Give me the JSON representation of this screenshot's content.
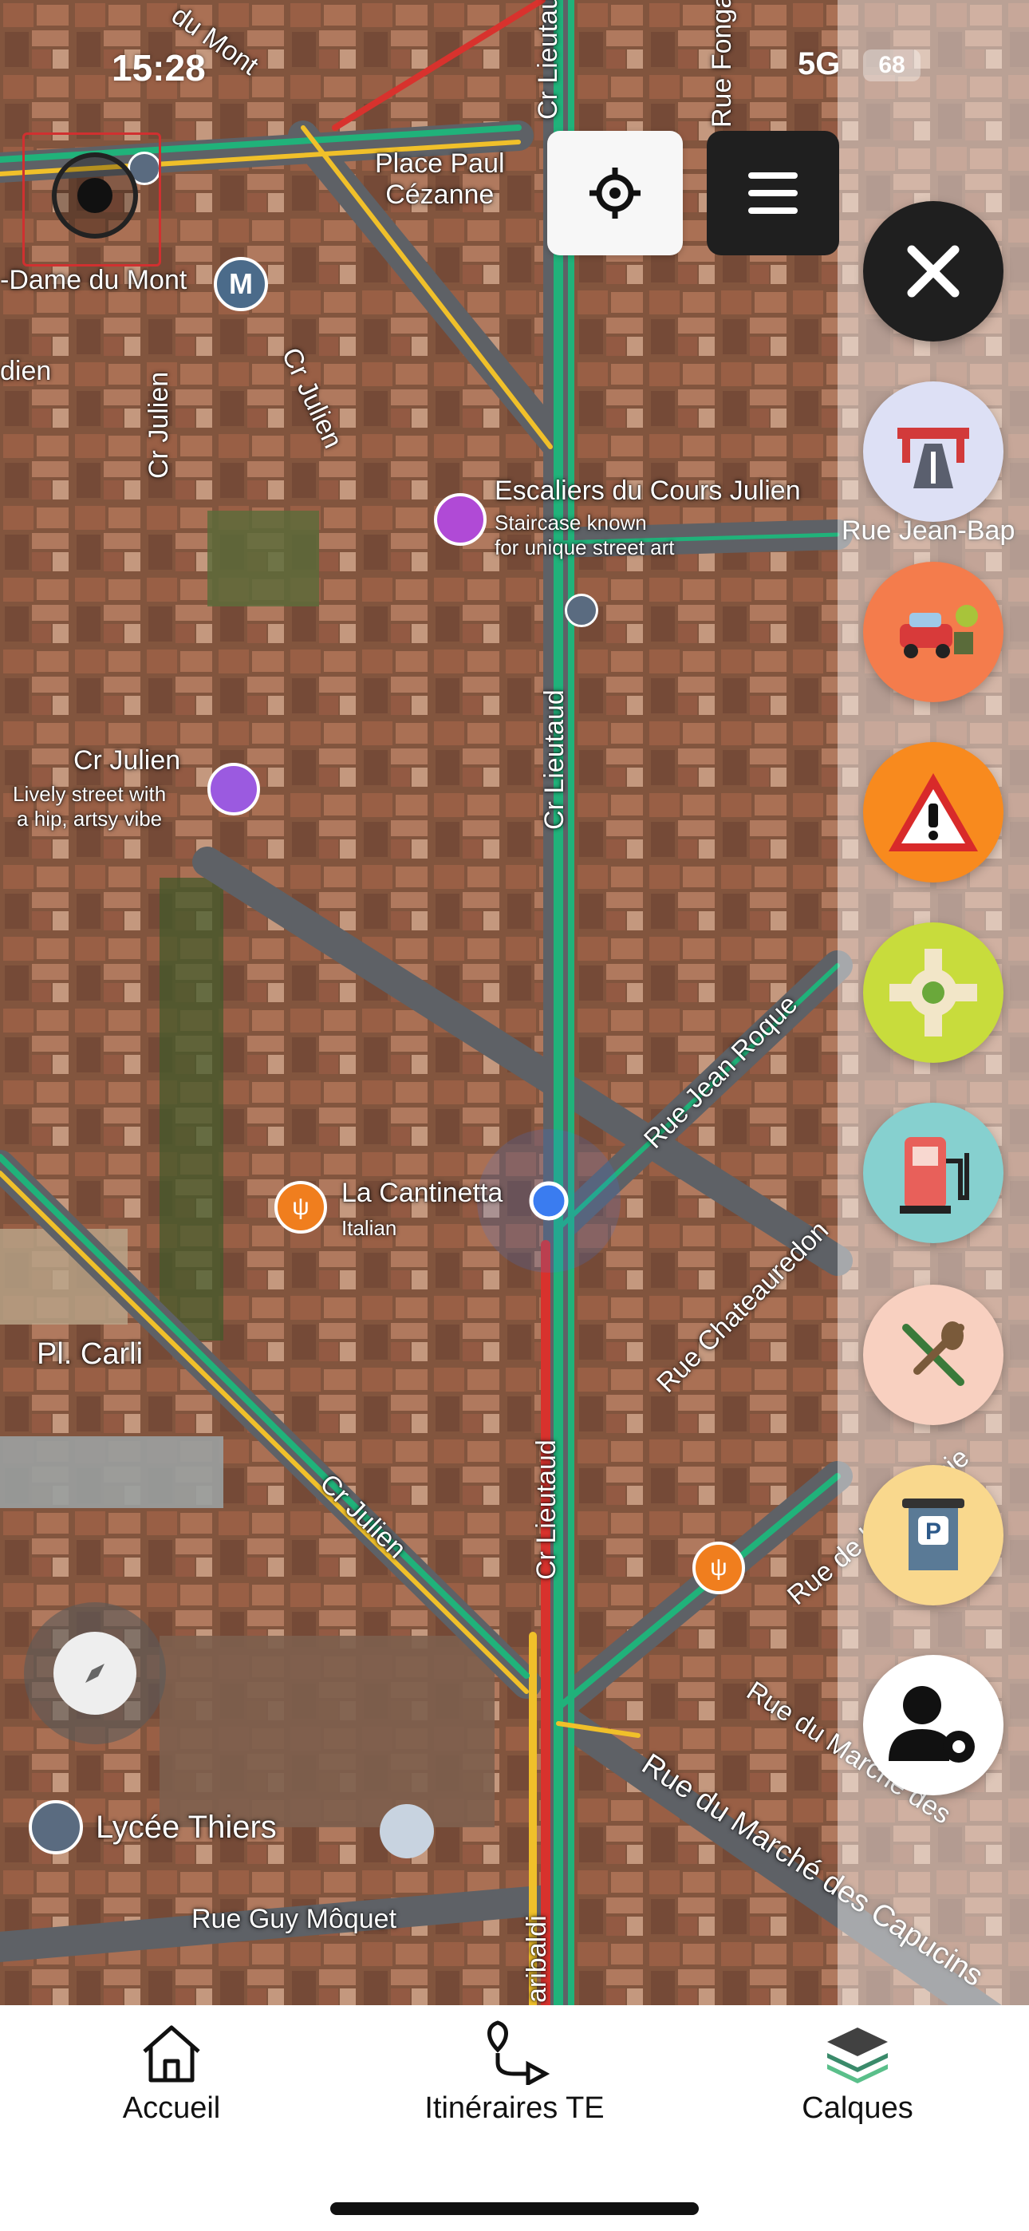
{
  "status_bar": {
    "time": "15:28",
    "network": "5G",
    "battery": "68"
  },
  "map": {
    "streets": {
      "cr_lieutaud_top": "Cr Lieutaud",
      "cr_lieutaud_mid": "Cr Lieutaud",
      "cr_lieutaud_low": "Cr Lieutaud",
      "rue_fongate": "Rue Fonga",
      "rue_jean_bap": "Rue Jean-Bap",
      "rue_jean_roque": "Rue Jean Roque",
      "rue_chateauredon": "Rue Chateauredon",
      "rue_academie": "Rue de l'Académie",
      "cr_julien_upper": "Cr Julien",
      "cr_julien_upper2": "Cr Julien",
      "cr_julien_lower": "Cr Julien",
      "rue_marche": "Rue du Marché des Capucins",
      "rue_marche2": "Rue du Marché des",
      "rue_guy_moquet": "Rue Guy Môquet",
      "garibaldi": "aribaldi",
      "place_paul_cezanne": "Place Paul\nCézanne",
      "dame_du_mont": "-Dame du Mont",
      "dien": "dien",
      "pl_carli": "Pl. Carli",
      "du_mont": "du Mont"
    },
    "pois": {
      "escaliers": {
        "title": "Escaliers du Cours Julien",
        "subtitle": "Staircase known\nfor unique street art"
      },
      "cr_julien": {
        "title": "Cr Julien",
        "subtitle": "Lively street with\na hip, artsy vibe"
      },
      "la_cantinetta": {
        "title": "La Cantinetta",
        "subtitle": "Italian"
      },
      "lycee_thiers": {
        "title": "Lycée Thiers"
      },
      "metro": {
        "letter": "M"
      }
    }
  },
  "layer_buttons": [
    {
      "name": "bridge",
      "bg": "#dde0f5"
    },
    {
      "name": "car-accident",
      "bg": "#f47c4c"
    },
    {
      "name": "warning",
      "bg": "#f88a1e"
    },
    {
      "name": "roundabout",
      "bg": "#c8dc3c"
    },
    {
      "name": "fuel-station",
      "bg": "#86d0cf"
    },
    {
      "name": "restaurant",
      "bg": "#f8d0c0"
    },
    {
      "name": "parking-ticket",
      "bg": "#f9d88d"
    },
    {
      "name": "user-settings",
      "bg": "#ffffff"
    }
  ],
  "bottom_nav": {
    "home_label": "Accueil",
    "routes_label": "Itinéraires TE",
    "layers_label": "Calques"
  },
  "colors": {
    "road_green": "#20b27a",
    "road_yellow": "#f0c02a",
    "road_red": "#d8322d",
    "location_blue": "#3a7cf0"
  }
}
